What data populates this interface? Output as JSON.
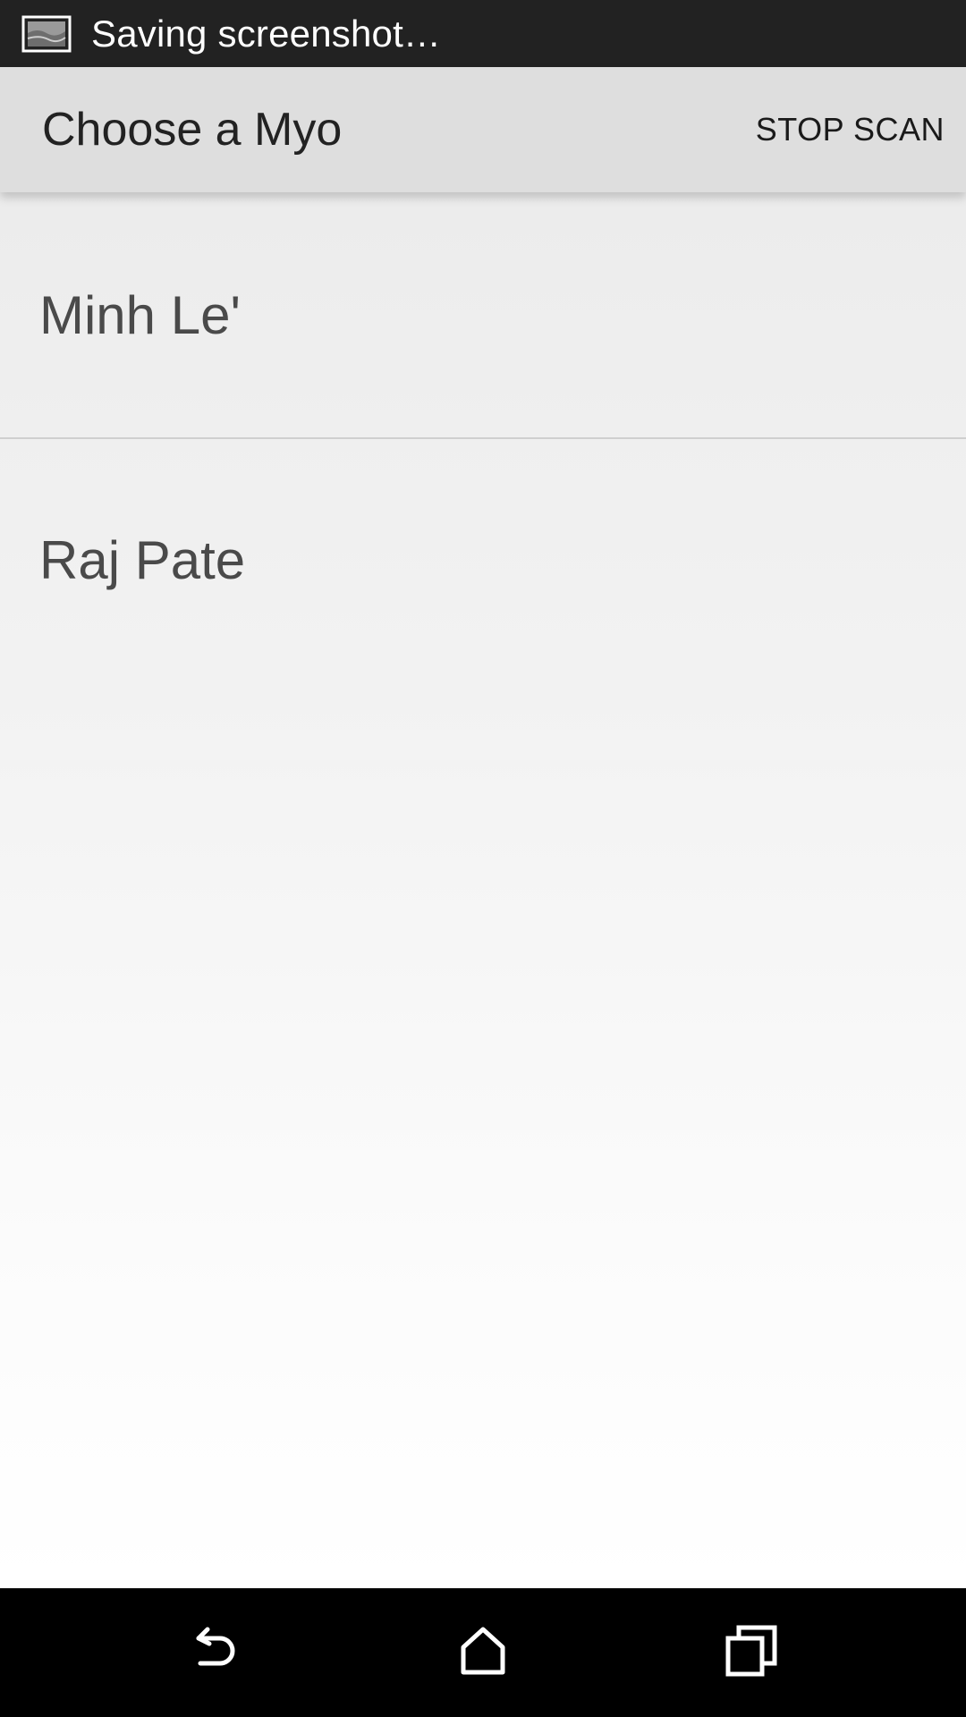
{
  "status_bar": {
    "icon": "screenshot-icon",
    "text": "Saving screenshot…"
  },
  "app_bar": {
    "title": "Choose a Myo",
    "action_label": "STOP SCAN"
  },
  "devices": [
    {
      "label": "Minh Le'"
    },
    {
      "label": "Raj Pate"
    }
  ],
  "nav_bar": {
    "back_icon": "back-icon",
    "home_icon": "home-icon",
    "recents_icon": "recents-icon"
  },
  "colors": {
    "status_bar_bg": "#222222",
    "app_bar_bg": "#dedede",
    "nav_bar_bg": "#000000",
    "list_text": "#4a4a4a"
  }
}
